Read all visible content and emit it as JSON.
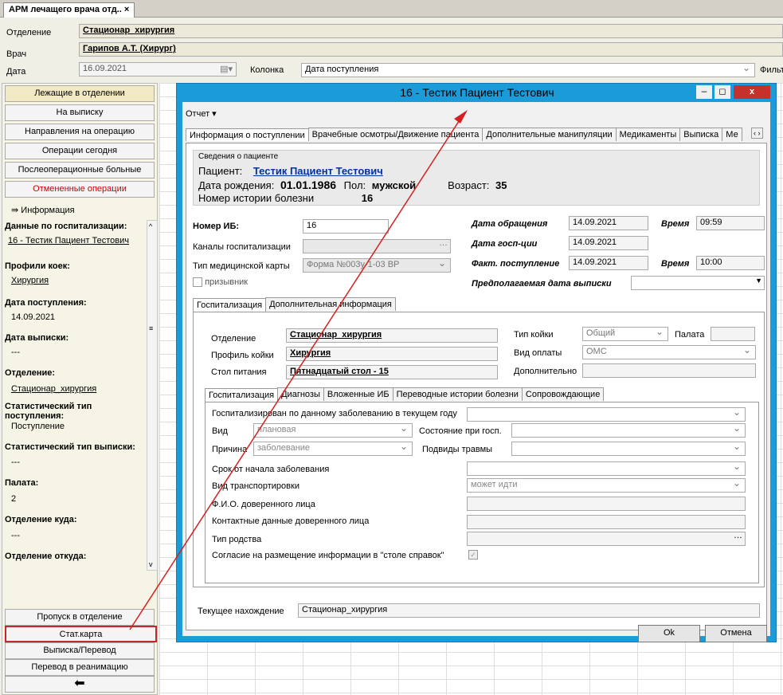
{
  "doc_tab": {
    "title": "АРМ лечащего врача отд..",
    "close": "×"
  },
  "header": {
    "dept_label": "Отделение",
    "dept_value": "Стационар_хирургия",
    "doctor_label": "Врач",
    "doctor_value": "Гарипов А.Т. (Хирург)",
    "date_label": "Дата",
    "date_value": "16.09.2021",
    "column_label": "Колонка",
    "column_value": "Дата поступления",
    "filter_label": "Фильт"
  },
  "left_menu": [
    "Лежащие в отделении",
    "На выписку",
    "Направления на операцию",
    "Операции сегодня",
    "Послеоперационные больные",
    "Отмененные операции"
  ],
  "info": {
    "title": "Информация",
    "hosp_title": "Данные по госпитализации:",
    "hosp_value": "16 - Тестик Пациент Тестович",
    "profile_title": "Профили коек:",
    "profile_value": "Хирургия",
    "admit_title": "Дата поступления:",
    "admit_value": "14.09.2021",
    "discharge_title": "Дата выписки:",
    "discharge_value": "---",
    "dept_title": "Отделение:",
    "dept_value": "Стационар_хирургия",
    "stat_admit_title": "Статистический тип поступления:",
    "stat_admit_value": "Поступление",
    "stat_disch_title": "Статистический тип выписки:",
    "stat_disch_value": "---",
    "ward_title": "Палата:",
    "ward_value": "2",
    "to_title": "Отделение куда:",
    "to_value": "---",
    "from_title": "Отделение откуда:"
  },
  "bottom_buttons": [
    "Пропуск в отделение",
    "Стат.карта",
    "Выписка/Перевод",
    "Перевод в реанимацию"
  ],
  "back_icon": "arrow-back-icon",
  "dialog": {
    "title": "16 - Тестик Пациент Тестович",
    "report_menu": "Отчет ▾",
    "tabs": [
      "Информация о поступлении",
      "Врачебные осмотры/Движение пациента",
      "Дополнительные манипуляции",
      "Медикаменты",
      "Выписка",
      "Ме"
    ],
    "patient_group": "Сведения о пациенте",
    "patient_label": "Пациент:",
    "patient_name": "Тестик Пациент Тестович",
    "dob_label": "Дата рождения:",
    "dob_value": "01.01.1986",
    "sex_label": "Пол:",
    "sex_value": "мужской",
    "age_label": "Возраст:",
    "age_value": "35",
    "hist_label": "Номер истории болезни",
    "hist_value": "16",
    "ib_label": "Номер ИБ:",
    "ib_value": "16",
    "channels_label": "Каналы госпитализации",
    "card_label": "Тип медицинской карты",
    "card_value": "Форма №003у-1-03 ВР",
    "conscript_label": "призывник",
    "appeal_label": "Дата обращения",
    "appeal_value": "14.09.2021",
    "time_label": "Время",
    "appeal_time": "09:59",
    "hosp_date_label": "Дата госп-ции",
    "hosp_date_value": "14.09.2021",
    "fact_label": "Факт. поступление",
    "fact_value": "14.09.2021",
    "fact_time": "10:00",
    "planned_label": "Предполагаемая дата выписки",
    "sub_tabs": [
      "Госпитализация",
      "Дополнительная информация"
    ],
    "dept_label": "Отделение",
    "dept_value": "Стационар_хирургия",
    "bed_type_label": "Тип койки",
    "bed_type_value": "Общий",
    "ward_label": "Палата",
    "bed_profile_label": "Профиль койки",
    "bed_profile_value": "Хирургия",
    "pay_label": "Вид оплаты",
    "pay_value": "ОМС",
    "diet_label": "Стол питания",
    "diet_value": "Пятнадцатый стол - 15",
    "extra_label": "Дополнительно",
    "inner_tabs": [
      "Госпитализация",
      "Диагнозы",
      "Вложенные ИБ",
      "Переводные истории болезни",
      "Сопровождающие"
    ],
    "q_this_year": "Госпитализирован по данному заболеванию в текущем году",
    "kind_label": "Вид",
    "kind_value": "плановая",
    "state_label": "Состояние при госп.",
    "reason_label": "Причина",
    "reason_value": "заболевание",
    "trauma_label": "Подвиды травмы",
    "onset_label": "Срок от начала заболевания",
    "transport_label": "Вид транспортировки",
    "transport_value": "может идти",
    "trustee_label": "Ф.И.О. доверенного лица",
    "trustee_contact_label": "Контактные данные доверенного лица",
    "relation_label": "Тип родства",
    "consent_label": "Согласие на размещение информации в \"столе справок\"",
    "current_label": "Текущее нахождение",
    "current_value": "Стационар_хирургия",
    "ok": "Ok",
    "cancel": "Отмена"
  }
}
